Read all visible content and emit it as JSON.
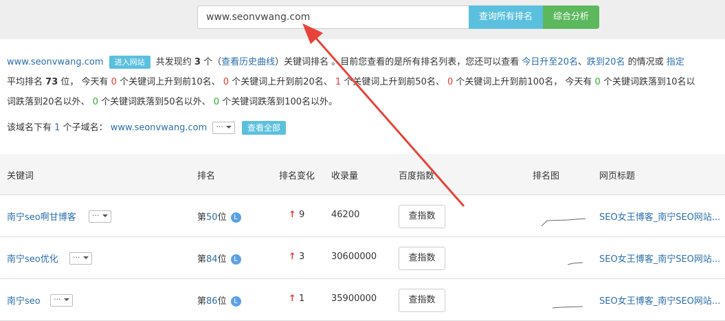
{
  "search": {
    "value": "www.seonvwang.com"
  },
  "buttons": {
    "query_all": "查询所有排名",
    "analysis": "综合分析"
  },
  "info": {
    "domain": "www.seonvwang.com",
    "enter_site": "进入网站",
    "found_prefix": "共发现约",
    "found_count": "3",
    "found_mid": "个（",
    "history_link": "查看历史曲线",
    "found_suffix": "）关键词排名 。目前您查看的是所有排名列表，您还可以查看",
    "today_up": "今日升至20名",
    "sep1": "、",
    "drop": "跌到20名",
    "tail": "的情况或",
    "specify": "指定",
    "avg_prefix": "平均排名",
    "avg_value": "73",
    "avg_suffix": "位，  今天有",
    "n1": "0",
    "t1": "个关键词上升到前10名、",
    "n2": "0",
    "t2": "个关键词上升到前20名、",
    "n3": "1",
    "t3": "个关键词上升到前50名、",
    "n4": "0",
    "t4": "个关键词上升到前100名，  今天有",
    "n5": "0",
    "t5": "个关键词跌落到10名以",
    "line3_a": "词跌落到20名以外、",
    "n6": "0",
    "t6": "个关键词跌落到50名以外、",
    "n7": "0",
    "t7": "个关键词跌落到100名以外。"
  },
  "subdomain": {
    "prefix": "该域名下有",
    "count": "1",
    "mid": "个子域名：",
    "domain": "www.seonvwang.com",
    "more": "···",
    "view_all": "查看全部"
  },
  "table": {
    "headers": [
      "关键词",
      "排名",
      "排名变化",
      "收录量",
      "百度指数",
      "排名图",
      "网页标题"
    ],
    "rows": [
      {
        "keyword": "南宁seo啊甘博客",
        "rank_prefix": "第",
        "rank": "50",
        "rank_suffix": "位",
        "change": "9",
        "volume": "46200",
        "index_btn": "查指数",
        "title": "SEO女王博客_南宁SEO网站..."
      },
      {
        "keyword": "南宁seo优化",
        "rank_prefix": "第",
        "rank": "84",
        "rank_suffix": "位",
        "change": "3",
        "volume": "30600000",
        "index_btn": "查指数",
        "title": "SEO女王博客_南宁SEO网站..."
      },
      {
        "keyword": "南宁seo",
        "rank_prefix": "第",
        "rank": "86",
        "rank_suffix": "位",
        "change": "1",
        "volume": "35900000",
        "index_btn": "查指数",
        "title": "SEO女王博客_南宁SEO网站..."
      }
    ]
  },
  "icons": {
    "clock": "clock-icon",
    "up_arrow": "up-arrow-icon",
    "dropdown": "chevron-down-icon"
  },
  "colors": {
    "accent_blue": "#5bc0de",
    "accent_green": "#5cb85c",
    "up_red": "#e33333",
    "annotation_arrow": "#e8423a"
  }
}
